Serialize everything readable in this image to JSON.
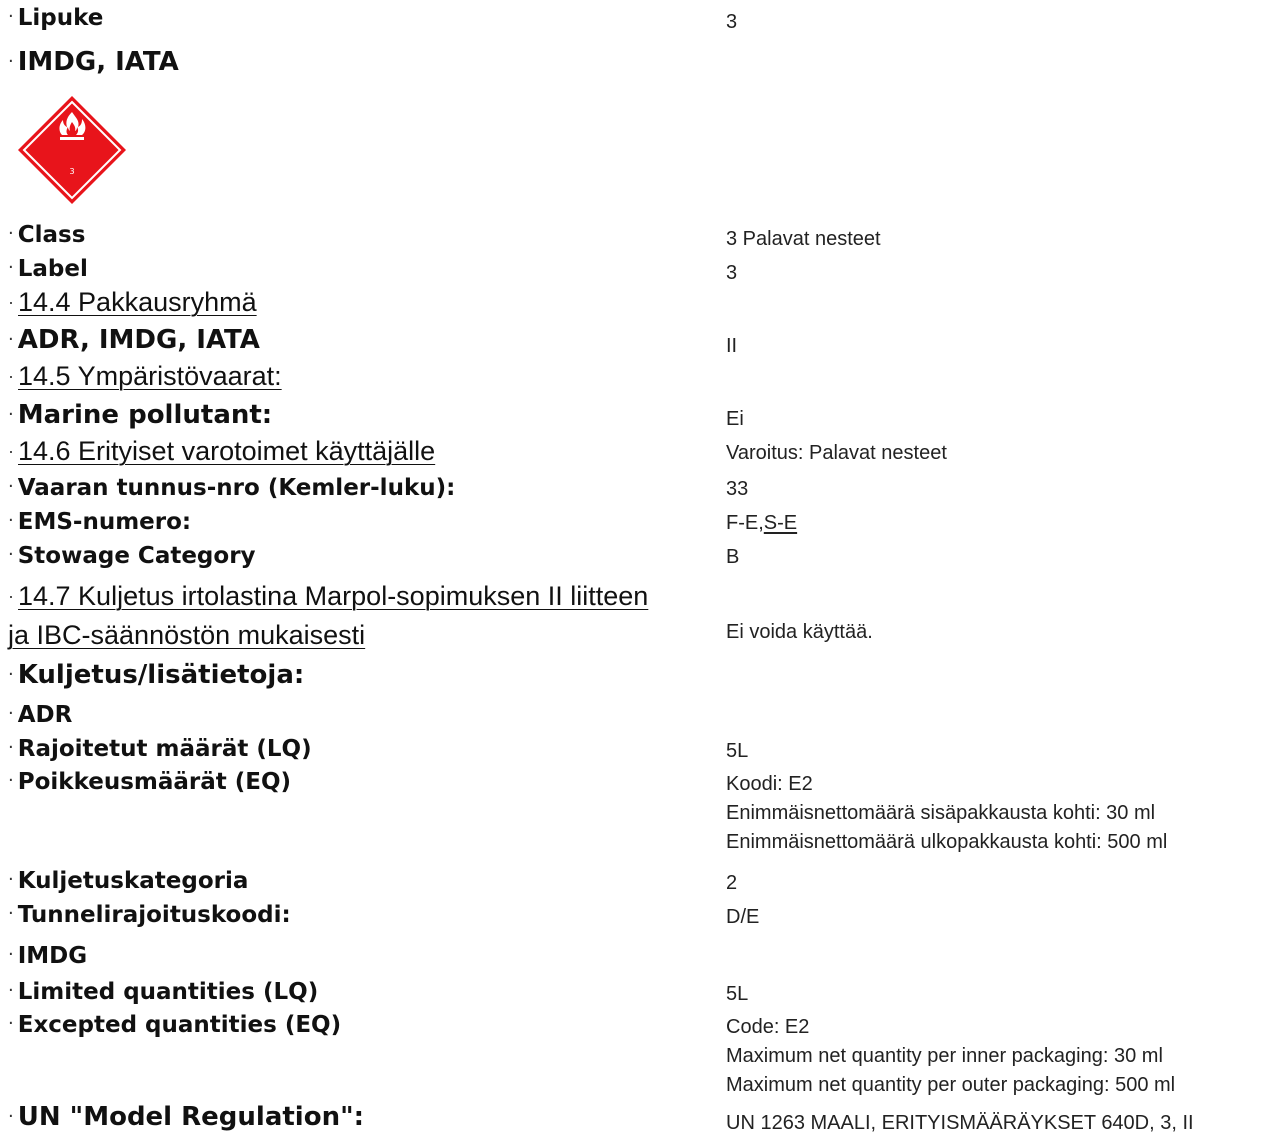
{
  "lipuke": {
    "label": "Lipuke",
    "value": "3"
  },
  "imdg_iata": {
    "label": "IMDG, IATA"
  },
  "hazard_label": {
    "number": "3",
    "color": "#e8141b"
  },
  "class_row": {
    "label": "Class",
    "value": "3 Palavat nesteet"
  },
  "label_row": {
    "label": "Label",
    "value": "3"
  },
  "s14_4": {
    "label": "14.4 Pakkausryhmä"
  },
  "adr_imdg_iata": {
    "label": "ADR, IMDG, IATA",
    "value": "II"
  },
  "s14_5": {
    "label": "14.5 Ympäristövaarat:"
  },
  "marine": {
    "label": "Marine pollutant:",
    "value": "Ei"
  },
  "s14_6": {
    "label": "14.6 Erityiset varotoimet käyttäjälle",
    "value": "Varoitus: Palavat nesteet"
  },
  "kemler": {
    "label": "Vaaran tunnus-nro (Kemler-luku):",
    "value": "33"
  },
  "ems": {
    "label": "EMS-numero:",
    "value_a": "F-E,",
    "value_b": "S-E"
  },
  "stowage": {
    "label": "Stowage Category",
    "value": "B"
  },
  "s14_7": {
    "label_line1": "14.7 Kuljetus irtolastina Marpol-sopimuksen II liitteen",
    "label_line2": "ja IBC-säännöstön mukaisesti",
    "value": "Ei voida käyttää."
  },
  "kuljetus": {
    "label": "Kuljetus/lisätietoja:"
  },
  "adr": {
    "label": "ADR",
    "lq_label": "Rajoitetut määrät (LQ)",
    "lq_value": "5L",
    "eq_label": "Poikkeusmäärät (EQ)",
    "eq_values": [
      "Koodi: E2",
      "Enimmäisnettomäärä sisäpakkausta kohti: 30 ml",
      "Enimmäisnettomäärä ulkopakkausta kohti: 500 ml"
    ],
    "kat_label": "Kuljetuskategoria",
    "kat_value": "2",
    "tunnel_label": "Tunnelirajoituskoodi:",
    "tunnel_value": "D/E"
  },
  "imdg": {
    "label": "IMDG",
    "lq_label": "Limited quantities (LQ)",
    "lq_value": "5L",
    "eq_label": "Excepted quantities (EQ)",
    "eq_values": [
      "Code: E2",
      "Maximum net quantity per inner packaging: 30 ml",
      "Maximum net quantity per outer packaging: 500 ml"
    ]
  },
  "un_model": {
    "label": "UN \"Model Regulation\":",
    "value": "UN 1263 MAALI, ERITYISMÄÄRÄYKSET 640D, 3, II"
  }
}
